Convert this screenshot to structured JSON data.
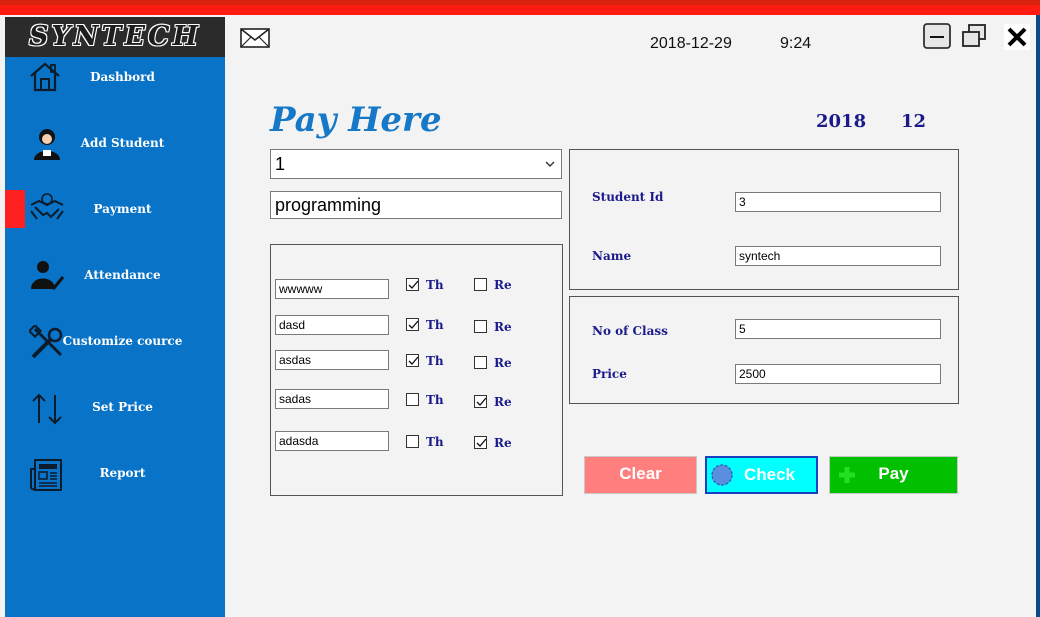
{
  "app": {
    "logo": "SYNTECH"
  },
  "sidebar": {
    "items": [
      {
        "label": "Dashbord",
        "icon": "home-icon"
      },
      {
        "label": "Add Student",
        "icon": "student-icon"
      },
      {
        "label": "Payment",
        "icon": "handshake-icon"
      },
      {
        "label": "Attendance",
        "icon": "attendance-icon"
      },
      {
        "label": "Customize cource",
        "icon": "tools-icon"
      },
      {
        "label": "Set Price",
        "icon": "sort-arrows-icon"
      },
      {
        "label": "Report",
        "icon": "newspaper-icon"
      }
    ],
    "active_index": 2
  },
  "header": {
    "date": "2018-12-29",
    "time": "9:24"
  },
  "page": {
    "title": "Pay Here",
    "year": "2018",
    "month": "12",
    "combo_value": "1",
    "course_value": "programming"
  },
  "classes": [
    {
      "name": "wwwww",
      "th": true,
      "re": false
    },
    {
      "name": "dasd",
      "th": true,
      "re": false
    },
    {
      "name": "asdas",
      "th": true,
      "re": false
    },
    {
      "name": "sadas",
      "th": false,
      "re": true
    },
    {
      "name": "adasda",
      "th": false,
      "re": true
    }
  ],
  "labels": {
    "th": "Th",
    "re": "Re"
  },
  "student": {
    "id_label": "Student Id",
    "id_value": "3",
    "name_label": "Name",
    "name_value": "syntech"
  },
  "payment": {
    "class_label": "No of Class",
    "class_value": "5",
    "price_label": "Price",
    "price_value": "2500"
  },
  "buttons": {
    "clear": "Clear",
    "check": "Check",
    "pay": "Pay"
  },
  "colors": {
    "sidebar": "#0873c7",
    "accent_red": "#ff1a12",
    "title": "#1678c7",
    "label": "#1a1a8c",
    "clear": "#ff7f7f",
    "check": "#00ffff",
    "pay": "#00c000"
  }
}
